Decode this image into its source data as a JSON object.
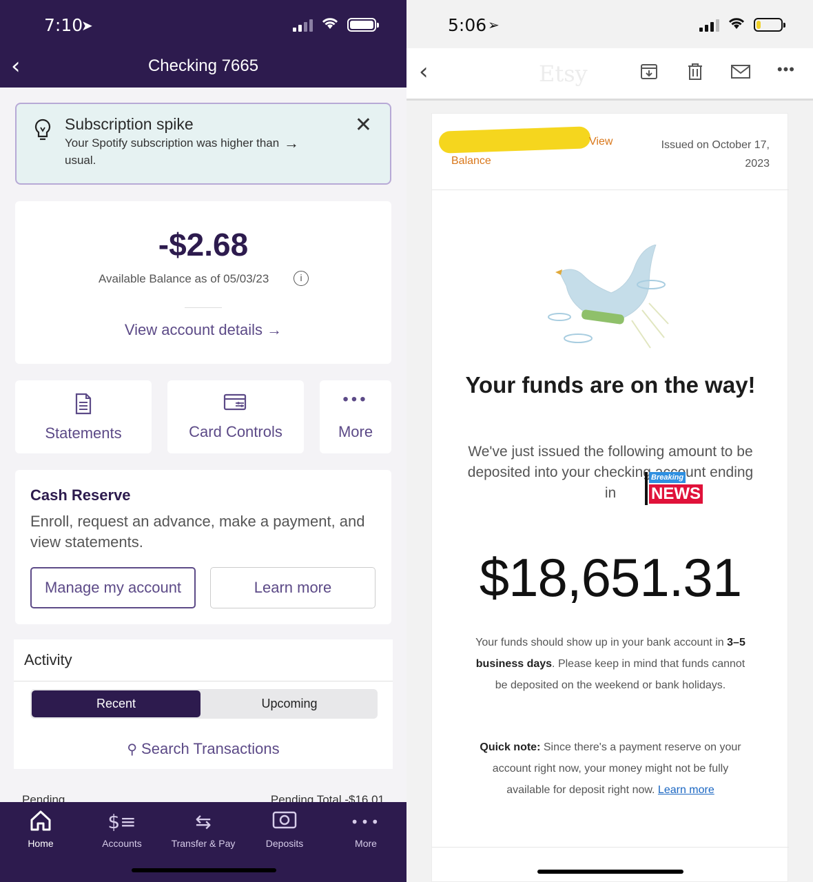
{
  "left": {
    "status_bar": {
      "time": "7:10"
    },
    "nav": {
      "title": "Checking 7665"
    },
    "alert": {
      "title": "Subscription spike",
      "body": "Your Spotify subscription was higher than usual."
    },
    "balance": {
      "amount": "-$2.68",
      "label": "Available Balance as of 05/03/23",
      "view_details": "View account details"
    },
    "quick_actions": [
      {
        "label": "Statements"
      },
      {
        "label": "Card Controls"
      },
      {
        "label": "More"
      }
    ],
    "cash_reserve": {
      "title": "Cash Reserve",
      "text": "Enroll, request an advance, make a payment, and view statements.",
      "manage_button": "Manage my account",
      "learn_button": "Learn more"
    },
    "activity": {
      "title": "Activity",
      "tab_recent": "Recent",
      "tab_upcoming": "Upcoming",
      "search": "Search Transactions",
      "pending_label": "Pending",
      "pending_total": "Pending Total -$16.01"
    },
    "tabbar": [
      {
        "label": "Home"
      },
      {
        "label": "Accounts"
      },
      {
        "label": "Transfer & Pay"
      },
      {
        "label": "Deposits"
      },
      {
        "label": "More"
      }
    ],
    "colors": {
      "brand": "#2d1b4e",
      "accent": "#5c4a87",
      "alert_bg": "#e6f2f2"
    }
  },
  "right": {
    "status_bar": {
      "time": "5:06"
    },
    "toolbar": {
      "ghost_title": "Etsy"
    },
    "email": {
      "view_link": "View",
      "balance_link": "Balance",
      "issued": "Issued on October 17, 2023",
      "headline": "Your funds are on the way!",
      "subtext": "We've just issued the following amount to be deposited into your checking account ending in",
      "overlay_small": "Breaking",
      "overlay_big": "NEWS",
      "amount": "$18,651.31",
      "para1_pre": "Your funds should show up in your bank account in ",
      "para1_bold": "3–5 business days",
      "para1_post": ". Please keep in mind that funds cannot be deposited on the weekend or bank holidays.",
      "para2_bold": "Quick note:",
      "para2_text": " Since there's a payment reserve on your account right now, your money might not be fully available for deposit right now. ",
      "para2_link": "Learn more"
    },
    "colors": {
      "link_orange": "#d9771a",
      "link_blue": "#1a66c2",
      "redaction": "#f5d61e",
      "news_red": "#e0123a"
    }
  }
}
